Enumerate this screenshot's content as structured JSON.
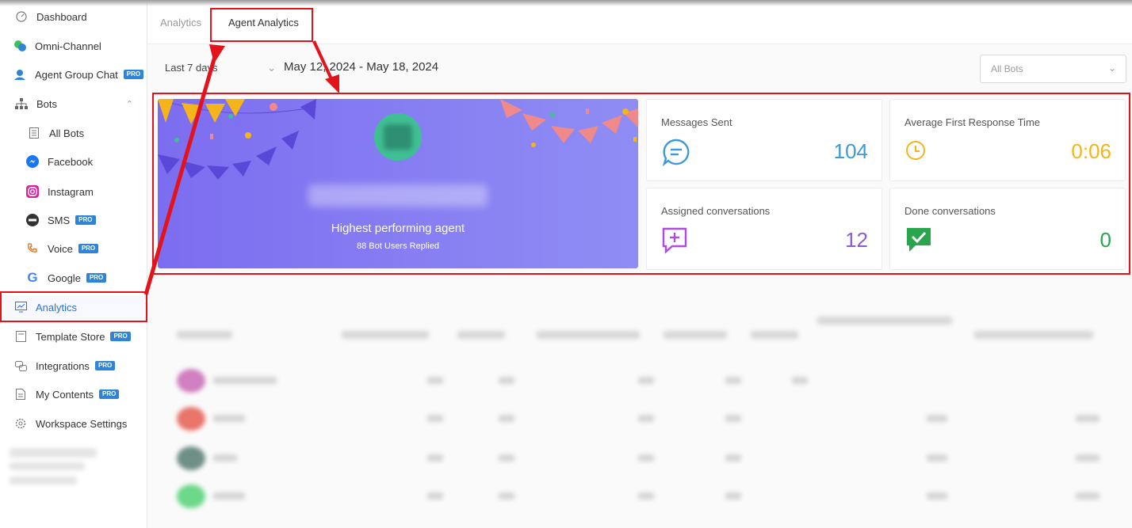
{
  "sidebar": {
    "items": [
      {
        "label": "Dashboard"
      },
      {
        "label": "Omni-Channel"
      },
      {
        "label": "Agent Group Chat",
        "badge": "PRO"
      },
      {
        "label": "Bots"
      },
      {
        "label": "All Bots"
      },
      {
        "label": "Facebook"
      },
      {
        "label": "Instagram"
      },
      {
        "label": "SMS",
        "badge": "PRO"
      },
      {
        "label": "Voice",
        "badge": "PRO"
      },
      {
        "label": "Google",
        "badge": "PRO"
      },
      {
        "label": "Analytics"
      },
      {
        "label": "Template Store",
        "badge": "PRO"
      },
      {
        "label": "Integrations",
        "badge": "PRO"
      },
      {
        "label": "My Contents",
        "badge": "PRO"
      },
      {
        "label": "Workspace Settings"
      }
    ]
  },
  "tabs": [
    {
      "label": "Analytics"
    },
    {
      "label": "Agent Analytics"
    }
  ],
  "filters": {
    "range": "Last 7 days",
    "date_range": "May 12, 2024 - May 18, 2024",
    "bots": "All Bots"
  },
  "hero": {
    "title": "Highest performing agent",
    "subtitle": "88 Bot Users Replied"
  },
  "stats": [
    {
      "label": "Messages Sent",
      "value": "104",
      "color": "#3d9ad6"
    },
    {
      "label": "Average First Response Time",
      "value": "0:06",
      "color": "#f4b41a"
    },
    {
      "label": "Assigned conversations",
      "value": "12",
      "color": "#8b5cd8"
    },
    {
      "label": "Done conversations",
      "value": "0",
      "color": "#2aa44d"
    }
  ],
  "colors": {
    "accent": "#2f6fd8",
    "annotation": "#e3121b",
    "hero": "#7c6df0"
  }
}
